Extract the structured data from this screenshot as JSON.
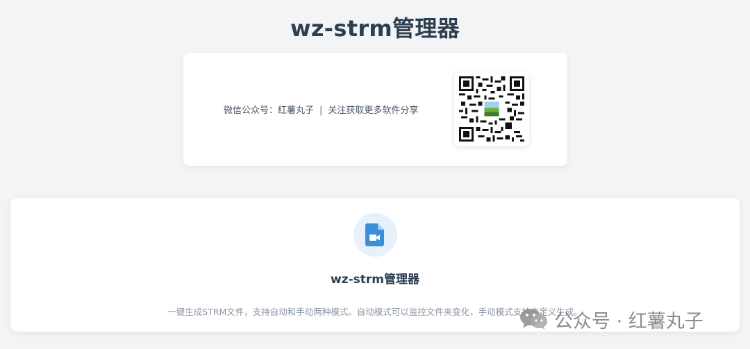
{
  "header": {
    "title": "wz-strm管理器"
  },
  "promo": {
    "label": "微信公众号：红薯丸子",
    "separator": "|",
    "slogan": "关注获取更多软件分享",
    "qr_icon": "qr-code-icon"
  },
  "tool": {
    "icon": "video-file-icon",
    "title": "wz-strm管理器",
    "description": "一键生成STRM文件，支持自动和手动两种模式。自动模式可以监控文件夹变化，手动模式支持自定义生成。"
  },
  "watermark": {
    "text": "公众号 · 红薯丸子",
    "icon": "wechat-icon"
  },
  "colors": {
    "accent": "#3b8fd9",
    "icon_bg": "#e6f1fb",
    "title": "#2c3e50",
    "muted": "#8a94a3"
  }
}
